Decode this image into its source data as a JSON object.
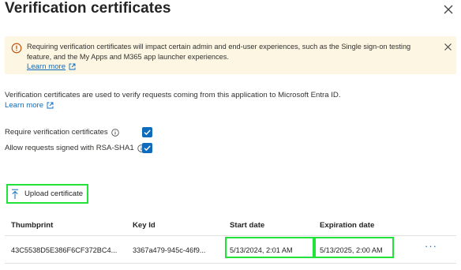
{
  "panel": {
    "title": "Verification certificates"
  },
  "banner": {
    "message": "Requiring verification certificates will impact certain admin and end-user experiences, such as the Single sign-on testing feature, and the My Apps and M365 app launcher experiences.",
    "link_label": "Learn more",
    "icon": "warning-info-icon",
    "background": "#fdf6e3"
  },
  "description": {
    "text": "Verification certificates are used to verify requests coming from this application to Microsoft Entra ID.",
    "link_label": "Learn more"
  },
  "options": {
    "require_label": "Require verification certificates",
    "require_checked": true,
    "rsa_label": "Allow requests signed with RSA-SHA1",
    "rsa_checked": true
  },
  "toolbar": {
    "upload_label": "Upload certificate"
  },
  "table": {
    "headers": {
      "thumbprint": "Thumbprint",
      "key_id": "Key Id",
      "start_date": "Start date",
      "expiration_date": "Expiration date"
    },
    "rows": [
      {
        "thumbprint": "43C5538D5E386F6CF372BC4...",
        "key_id": "3367a479-945c-46f9...",
        "start_date": "5/13/2024, 2:01 AM",
        "expiration_date": "5/13/2025, 2:00 AM",
        "actions": "···"
      }
    ]
  },
  "colors": {
    "accent": "#0f6cbd",
    "highlight": "#22e33a"
  }
}
